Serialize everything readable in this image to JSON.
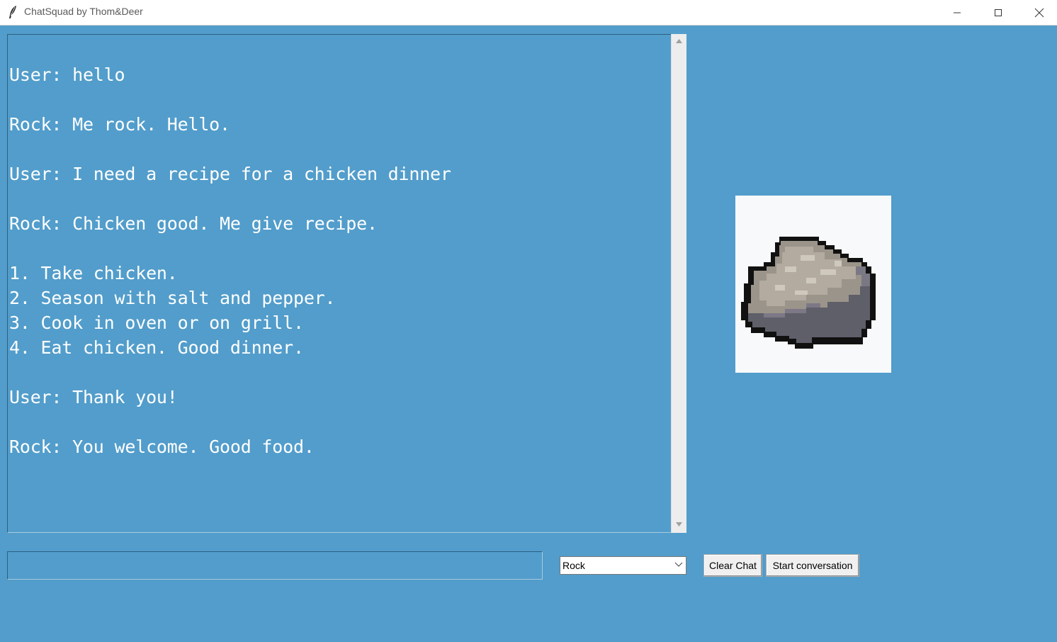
{
  "window": {
    "title": "ChatSquad by Thom&Deer",
    "icon": "feather-icon",
    "controls": [
      "minimize-icon",
      "maximize-icon",
      "close-icon"
    ]
  },
  "chat": {
    "transcript": "User: hello\n\nRock: Me rock. Hello.\n\nUser: I need a recipe for a chicken dinner\n\nRock: Chicken good. Me give recipe.\n\n1. Take chicken.\n2. Season with salt and pepper.\n3. Cook in oven or on grill.\n4. Eat chicken. Good dinner.\n\nUser: Thank you!\n\nRock: You welcome. Good food."
  },
  "avatar": {
    "icon": "rock-pixel-art-icon"
  },
  "input": {
    "value": "",
    "placeholder": ""
  },
  "persona_select": {
    "selected": "Rock"
  },
  "buttons": {
    "clear_label": "Clear Chat",
    "start_label": "Start conversation"
  },
  "colors": {
    "background": "#529dcb",
    "text": "#ffffff"
  }
}
